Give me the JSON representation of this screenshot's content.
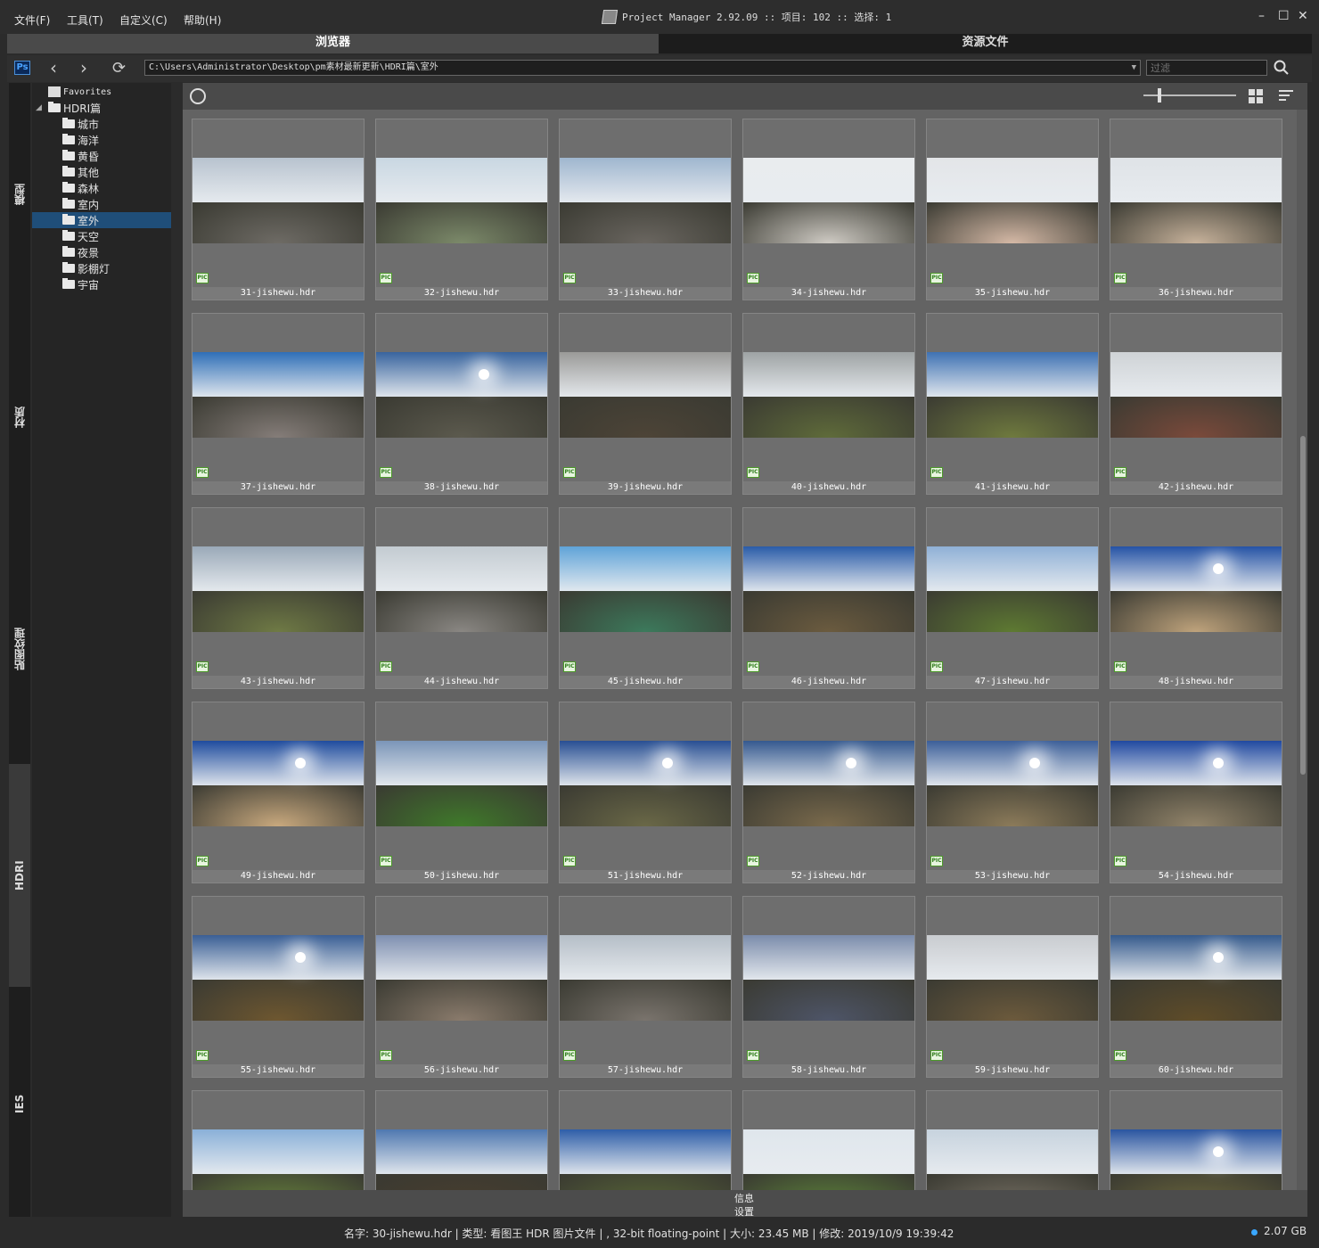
{
  "menu": [
    {
      "label": "文件(F)"
    },
    {
      "label": "工具(T)"
    },
    {
      "label": "自定义(C)"
    },
    {
      "label": "帮助(H)"
    }
  ],
  "title": "Project Manager 2.92.09  :: 项目: 102  :: 选择: 1",
  "window_controls": [
    "–",
    "☐",
    "✕"
  ],
  "tabs": {
    "browser": "浏览器",
    "assets": "资源文件"
  },
  "path": "C:\\Users\\Administrator\\Desktop\\pm素材最新更新\\HDRI篇\\室外",
  "filter_placeholder": "过滤",
  "vtabs": [
    "模型",
    "材质",
    "贴图纹理",
    "HDRI",
    "IES"
  ],
  "tree": {
    "favorites": "Favorites",
    "root": "HDRI篇",
    "folders": [
      "城市",
      "海洋",
      "黄昏",
      "其他",
      "森林",
      "室内",
      "室外",
      "天空",
      "夜景",
      "影棚灯",
      "宇宙"
    ],
    "selected": "室外"
  },
  "badge_text": "PIC",
  "items": [
    {
      "name": "31-jishewu.hdr",
      "sky": "#b8c3cf",
      "ground": "#6e6b65",
      "sun": false
    },
    {
      "name": "32-jishewu.hdr",
      "sky": "#c9d7e2",
      "ground": "#7c8a6a",
      "sun": false
    },
    {
      "name": "33-jishewu.hdr",
      "sky": "#9fb6cf",
      "ground": "#6a6660",
      "sun": false
    },
    {
      "name": "34-jishewu.hdr",
      "sky": "#e9ecee",
      "ground": "#cfcbc4",
      "sun": false
    },
    {
      "name": "35-jishewu.hdr",
      "sky": "#e3e5e8",
      "ground": "#d5b9a6",
      "sun": false
    },
    {
      "name": "36-jishewu.hdr",
      "sky": "#dfe3e7",
      "ground": "#c7b29b",
      "sun": false
    },
    {
      "name": "37-jishewu.hdr",
      "sky": "#2f6fb7",
      "ground": "#857d79",
      "sun": false
    },
    {
      "name": "38-jishewu.hdr",
      "sky": "#38649e",
      "ground": "#5c5a4e",
      "sun": true
    },
    {
      "name": "39-jishewu.hdr",
      "sky": "#9a9a98",
      "ground": "#4d4437",
      "sun": false
    },
    {
      "name": "40-jishewu.hdr",
      "sky": "#9ea3a4",
      "ground": "#5f6b3a",
      "sun": false
    },
    {
      "name": "41-jishewu.hdr",
      "sky": "#3f72b3",
      "ground": "#6f7a3e",
      "sun": false
    },
    {
      "name": "42-jishewu.hdr",
      "sky": "#cfd3d6",
      "ground": "#7b4a3b",
      "sun": false
    },
    {
      "name": "43-jishewu.hdr",
      "sky": "#9aa9b8",
      "ground": "#6f7a45",
      "sun": false
    },
    {
      "name": "44-jishewu.hdr",
      "sky": "#c3cbd1",
      "ground": "#8a8783",
      "sun": false
    },
    {
      "name": "45-jishewu.hdr",
      "sky": "#5fa3d8",
      "ground": "#3c7a5c",
      "sun": false
    },
    {
      "name": "46-jishewu.hdr",
      "sky": "#2a5ca8",
      "ground": "#6b5b3f",
      "sun": false
    },
    {
      "name": "47-jishewu.hdr",
      "sky": "#8fb0d6",
      "ground": "#5e7a32",
      "sun": false
    },
    {
      "name": "48-jishewu.hdr",
      "sky": "#2553a5",
      "ground": "#bfa37c",
      "sun": true
    },
    {
      "name": "49-jishewu.hdr",
      "sky": "#1f4c9e",
      "ground": "#c9a97e",
      "sun": true
    },
    {
      "name": "50-jishewu.hdr",
      "sky": "#7b95b8",
      "ground": "#3f7a2a",
      "sun": false
    },
    {
      "name": "51-jishewu.hdr",
      "sky": "#284f93",
      "ground": "#6a6847",
      "sun": true
    },
    {
      "name": "52-jishewu.hdr",
      "sky": "#35598f",
      "ground": "#7a6a4c",
      "sun": true
    },
    {
      "name": "53-jishewu.hdr",
      "sky": "#3c5f99",
      "ground": "#8c7b5a",
      "sun": true
    },
    {
      "name": "54-jishewu.hdr",
      "sky": "#2049a0",
      "ground": "#92846a",
      "sun": true
    },
    {
      "name": "55-jishewu.hdr",
      "sky": "#3a5f95",
      "ground": "#6e5730",
      "sun": true
    },
    {
      "name": "56-jishewu.hdr",
      "sky": "#7e8fb0",
      "ground": "#8a7b6c",
      "sun": false
    },
    {
      "name": "57-jishewu.hdr",
      "sky": "#b5bec7",
      "ground": "#7a746d",
      "sun": false
    },
    {
      "name": "58-jishewu.hdr",
      "sky": "#7b8cab",
      "ground": "#4e5568",
      "sun": false
    },
    {
      "name": "59-jishewu.hdr",
      "sky": "#c9ccd0",
      "ground": "#6c5a3c",
      "sun": false
    },
    {
      "name": "60-jishewu.hdr",
      "sky": "#355a8c",
      "ground": "#5f4c28",
      "sun": true
    },
    {
      "name": "",
      "sky": "#8ab0d8",
      "ground": "#6b8a3c",
      "sun": false
    },
    {
      "name": "",
      "sky": "#4f78b0",
      "ground": "#4a3d2d",
      "sun": false
    },
    {
      "name": "",
      "sky": "#2e5ea8",
      "ground": "#5a6a36",
      "sun": false
    },
    {
      "name": "",
      "sky": "#dfe6ec",
      "ground": "#5f8a3a",
      "sun": false
    },
    {
      "name": "",
      "sky": "#c7d3de",
      "ground": "#7b7468",
      "sun": false
    },
    {
      "name": "",
      "sky": "#2a55a0",
      "ground": "#6f6a3c",
      "sun": true
    }
  ],
  "info_tabs": [
    "信息",
    "设置"
  ],
  "status": "名字: 30-jishewu.hdr | 类型: 看图王 HDR 图片文件 | , 32-bit floating-point | 大小: 23.45 MB | 修改: 2019/10/9 19:39:42",
  "memory": "2.07 GB",
  "colors": {
    "accent": "#1f4e79",
    "memory_dot": "#3aa7ff"
  }
}
